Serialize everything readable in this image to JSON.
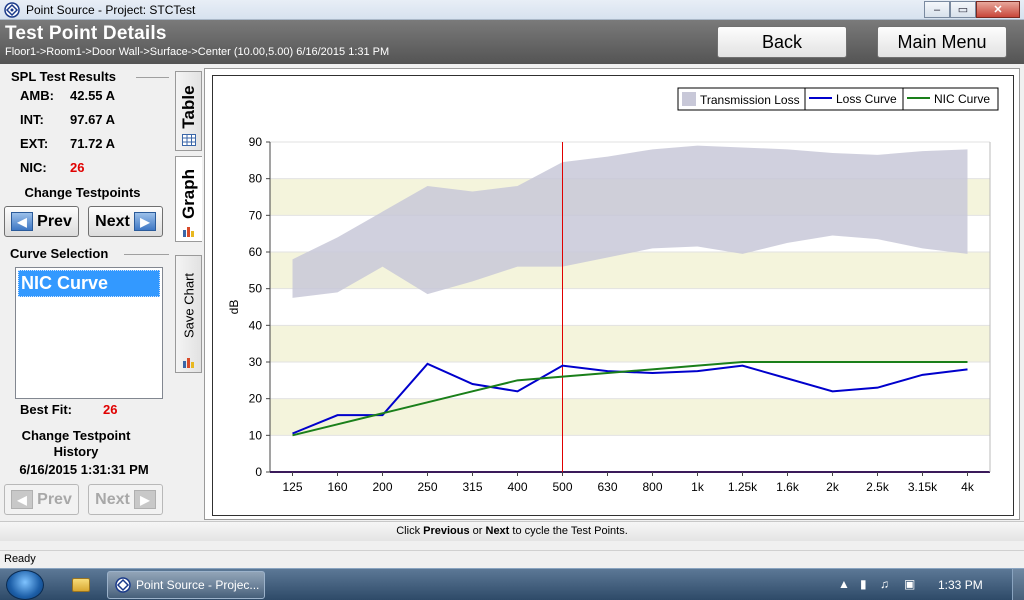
{
  "window": {
    "title": "Point Source - Project: STCTest",
    "controls": {
      "minimize": "–",
      "maximize": "▭",
      "close": "✕"
    }
  },
  "header": {
    "title": "Test Point Details",
    "breadcrumb": "Floor1->Room1->Door Wall->Surface->Center (10.00,5.00) 6/16/2015 1:31 PM",
    "back_label": "Back",
    "main_menu_label": "Main Menu"
  },
  "spl": {
    "title": "SPL Test Results",
    "rows": [
      {
        "label": "AMB:",
        "value": "42.55 A"
      },
      {
        "label": "INT:",
        "value": "97.67 A"
      },
      {
        "label": "EXT:",
        "value": "71.72 A"
      },
      {
        "label": "NIC:",
        "value": "26"
      }
    ]
  },
  "testpoints": {
    "title": "Change Testpoints",
    "prev_label": "Prev",
    "next_label": "Next"
  },
  "curve_selection": {
    "title": "Curve Selection",
    "selected": "NIC Curve",
    "best_fit_label": "Best Fit:",
    "best_fit_value": "26"
  },
  "history": {
    "title": "Change Testpoint History",
    "timestamp": "6/16/2015 1:31:31 PM",
    "prev_label": "Prev",
    "next_label": "Next"
  },
  "tabs": {
    "table": "Table",
    "graph": "Graph",
    "save_chart": "Save Chart"
  },
  "hint": {
    "prefix": "Click ",
    "previous": "Previous",
    "middle": " or ",
    "next": "Next",
    "suffix": " to cycle the Test Points."
  },
  "status": {
    "text": "Ready"
  },
  "taskbar": {
    "app_label": "Point Source - Projec...",
    "clock": "1:33 PM"
  },
  "colors": {
    "loss_curve": "#0000cc",
    "nic_curve": "#1a7f1a",
    "transmission_band": "#c8c8d8",
    "marker_line": "#e00000",
    "grid_band": "#f4f4dc"
  },
  "chart_data": {
    "type": "line",
    "ylabel": "dB",
    "xlabel": "",
    "title": "",
    "ylim": [
      0,
      90
    ],
    "yticks": [
      0,
      10,
      20,
      30,
      40,
      50,
      60,
      70,
      80,
      90
    ],
    "categories": [
      "125",
      "160",
      "200",
      "250",
      "315",
      "400",
      "500",
      "630",
      "800",
      "1k",
      "1.25k",
      "1.6k",
      "2k",
      "2.5k",
      "3.15k",
      "4k"
    ],
    "legend_position": "top-right",
    "marker_category": "500",
    "band": {
      "name": "Transmission Loss",
      "lower": [
        47.5,
        49,
        56,
        48.5,
        52,
        56,
        56,
        58.5,
        61,
        61.5,
        59.5,
        62.5,
        64.5,
        63.5,
        61,
        59.5
      ],
      "upper": [
        58,
        64,
        71,
        78,
        76.5,
        78,
        84.5,
        86,
        88,
        89,
        88.5,
        88,
        87,
        86.5,
        87.5,
        88
      ]
    },
    "series": [
      {
        "name": "Loss Curve",
        "values": [
          10.5,
          15.5,
          15.5,
          29.5,
          24,
          22,
          29,
          27.5,
          27,
          27.5,
          29,
          25.5,
          22,
          23,
          26.5,
          28
        ]
      },
      {
        "name": "NIC Curve",
        "values": [
          10,
          13,
          16,
          19,
          22,
          25,
          26,
          27,
          28,
          29,
          30,
          30,
          30,
          30,
          30,
          30
        ]
      }
    ]
  }
}
